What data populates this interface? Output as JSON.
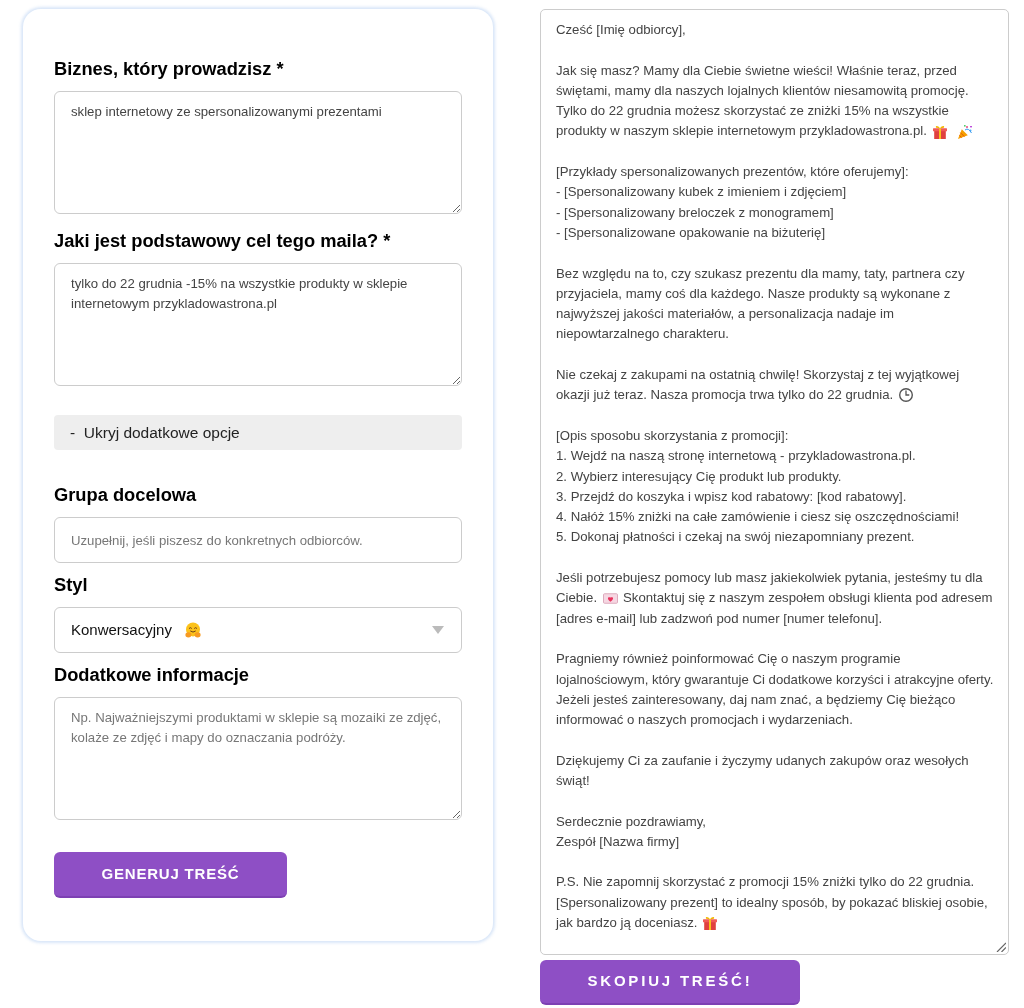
{
  "form": {
    "fields": [
      {
        "kind": "textarea",
        "label": "Biznes, który prowadzisz *",
        "value": "sklep internetowy ze spersonalizowanymi prezentami"
      },
      {
        "kind": "textarea",
        "label": "Jaki jest podstawowy cel tego maila? *",
        "value": "tylko do 22 grudnia -15% na wszystkie produkty w sklepie internetowym przykladowastrona.pl"
      }
    ],
    "options_toggle": {
      "label": "-  Ukryj dodatkowe opcje",
      "expanded": true
    },
    "extra_fields": [
      {
        "kind": "input",
        "label": "Grupa docelowa",
        "placeholder": "Uzupełnij, jeśli piszesz do konkretnych odbiorców."
      },
      {
        "kind": "select",
        "label": "Styl",
        "value": [
          {
            "kind": "text",
            "text": "Konwersacyjny"
          },
          {
            "kind": "hug"
          }
        ]
      },
      {
        "kind": "textarea",
        "label": "Dodatkowe informacje",
        "placeholder": "Np. Najważniejszymi produktami w sklepie są mozaiki ze zdjęć, kolaże ze zdjęć i mapy do oznaczania podróży."
      }
    ],
    "submit_button": "GENERUJ TREŚĆ"
  },
  "output": {
    "paragraphs": [
      [
        [
          {
            "kind": "text",
            "text": "Cześć [Imię odbiorcy],"
          }
        ]
      ],
      [
        [
          {
            "kind": "text",
            "text": "Jak się masz? Mamy dla Ciebie świetne wieści! Właśnie teraz, przed świętami, mamy dla naszych lojalnych klientów niesamowitą promocję. Tylko do 22 grudnia możesz skorzystać ze zniżki 15% na wszystkie"
          }
        ],
        [
          {
            "kind": "text",
            "text": "produkty w naszym sklepie internetowym przykladowastrona.pl."
          },
          {
            "kind": "gift"
          },
          {
            "kind": "party"
          }
        ]
      ],
      [
        [
          {
            "kind": "text",
            "text": "[Przykłady spersonalizowanych prezentów, które oferujemy]:"
          }
        ],
        [
          {
            "kind": "text",
            "text": "- [Spersonalizowany kubek z imieniem i zdjęciem]"
          }
        ],
        [
          {
            "kind": "text",
            "text": "- [Spersonalizowany breloczek z monogramem]"
          }
        ],
        [
          {
            "kind": "text",
            "text": "- [Spersonalizowane opakowanie na biżuterię]"
          }
        ]
      ],
      [
        [
          {
            "kind": "text",
            "text": "Bez względu na to, czy szukasz prezentu dla mamy, taty, partnera czy przyjaciela, mamy coś dla każdego. Nasze produkty są wykonane z najwyższej jakości materiałów, a personalizacja nadaje im niepowtarzalnego charakteru."
          }
        ]
      ],
      [
        [
          {
            "kind": "text",
            "text": "Nie czekaj z zakupami na ostatnią chwilę! Skorzystaj z tej wyjątkowej"
          }
        ],
        [
          {
            "kind": "text",
            "text": "okazji już teraz. Nasza promocja trwa tylko do 22 grudnia."
          },
          {
            "kind": "clock"
          }
        ]
      ],
      [
        [
          {
            "kind": "text",
            "text": "[Opis sposobu skorzystania z promocji]:"
          }
        ],
        [
          {
            "kind": "text",
            "text": "1. Wejdź na naszą stronę internetową - przykladowastrona.pl."
          }
        ],
        [
          {
            "kind": "text",
            "text": "2. Wybierz interesujący Cię produkt lub produkty."
          }
        ],
        [
          {
            "kind": "text",
            "text": "3. Przejdź do koszyka i wpisz kod rabatowy: [kod rabatowy]."
          }
        ],
        [
          {
            "kind": "text",
            "text": "4. Nałóż 15% zniżki na całe zamówienie i ciesz się oszczędnościami!"
          }
        ],
        [
          {
            "kind": "text",
            "text": "5. Dokonaj płatności i czekaj na swój niezapomniany prezent."
          }
        ]
      ],
      [
        [
          {
            "kind": "text",
            "text": "Jeśli potrzebujesz pomocy lub masz jakiekolwiek pytania, jesteśmy tu dla"
          }
        ],
        [
          {
            "kind": "text",
            "text": "Ciebie."
          },
          {
            "kind": "letter"
          },
          {
            "kind": "text",
            "text": "Skontaktuj się z naszym zespołem obsługi klienta pod adresem"
          }
        ],
        [
          {
            "kind": "text",
            "text": "[adres e-mail] lub zadzwoń pod numer [numer telefonu]."
          }
        ]
      ],
      [
        [
          {
            "kind": "text",
            "text": "Pragniemy również poinformować Cię o naszym programie lojalnościowym, który gwarantuje Ci dodatkowe korzyści i atrakcyjne oferty. Jeżeli jesteś zainteresowany, daj nam znać, a będziemy Cię bieżąco informować o naszych promocjach i wydarzeniach."
          }
        ]
      ],
      [
        [
          {
            "kind": "text",
            "text": "Dziękujemy Ci za zaufanie i życzymy udanych zakupów oraz wesołych świąt!"
          }
        ]
      ],
      [
        [
          {
            "kind": "text",
            "text": "Serdecznie pozdrawiamy,"
          }
        ],
        [
          {
            "kind": "text",
            "text": "Zespół [Nazwa firmy]"
          }
        ]
      ],
      [
        [
          {
            "kind": "text",
            "text": "P.S. Nie zapomnij skorzystać z promocji 15% zniżki tylko do 22 grudnia. [Spersonalizowany prezent] to idealny sposób, by pokazać bliskiej osobie,"
          }
        ],
        [
          {
            "kind": "text",
            "text": "jak bardzo ją doceniasz."
          },
          {
            "kind": "gift"
          }
        ]
      ]
    ]
  },
  "copy_button": "SKOPIUJ TREŚĆ!"
}
